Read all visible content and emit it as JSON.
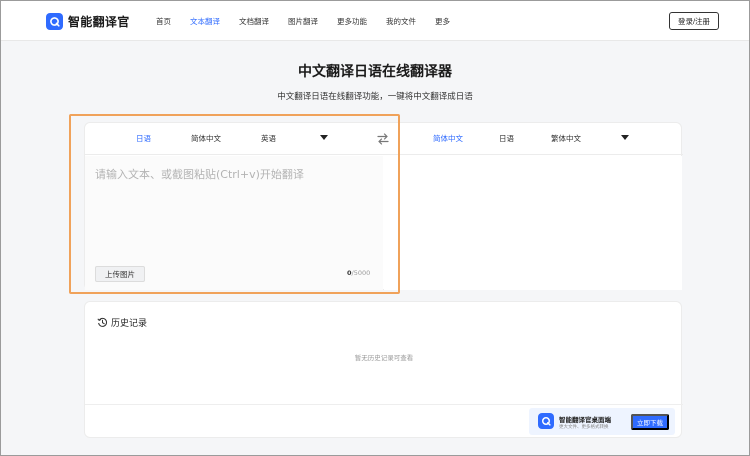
{
  "app": {
    "name": "智能翻译官"
  },
  "nav": {
    "items": [
      "首页",
      "文本翻译",
      "文档翻译",
      "图片翻译",
      "更多功能",
      "我的文件",
      "更多"
    ],
    "active_index": 1,
    "login_label": "登录/注册"
  },
  "page": {
    "title": "中文翻译日语在线翻译器",
    "subtitle": "中文翻译日语在线翻译功能，一键将中文翻译成日语"
  },
  "translator": {
    "source_langs": [
      "日语",
      "简体中文",
      "英语"
    ],
    "source_active": "日语",
    "target_langs": [
      "简体中文",
      "日语",
      "繁体中文"
    ],
    "target_active": "简体中文",
    "input": {
      "value": "",
      "placeholder": "请输入文本、或截图粘贴(Ctrl+v)开始翻译"
    },
    "upload_label": "上传图片",
    "char_count": "0",
    "char_limit": "/5000"
  },
  "history": {
    "title": "历史记录",
    "empty_text": "暂无历史记录可查看"
  },
  "download": {
    "title": "智能翻译官桌面端",
    "subtitle": "更大文件、更多格式转换",
    "button_label": "立即下载"
  },
  "colors": {
    "accent": "#2f6bff",
    "highlight": "#f0a25a",
    "page_bg": "#f5f6f8"
  }
}
